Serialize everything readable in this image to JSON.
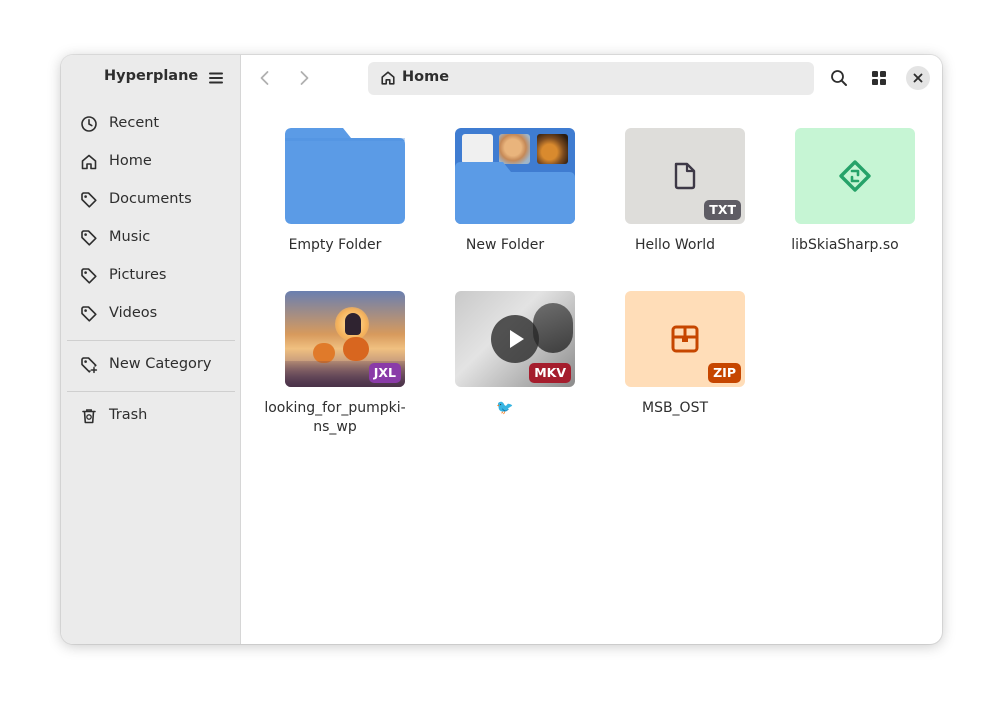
{
  "sidebar": {
    "app_title": "Hyperplane",
    "items": [
      {
        "label": "Recent",
        "icon": "clock-icon"
      },
      {
        "label": "Home",
        "icon": "home-icon"
      },
      {
        "label": "Documents",
        "icon": "tag-icon"
      },
      {
        "label": "Music",
        "icon": "tag-icon"
      },
      {
        "label": "Pictures",
        "icon": "tag-icon"
      },
      {
        "label": "Videos",
        "icon": "tag-icon"
      }
    ],
    "new_category": {
      "label": "New Category",
      "icon": "tag-add-icon"
    },
    "trash": {
      "label": "Trash",
      "icon": "trash-icon"
    }
  },
  "header": {
    "path": "Home",
    "path_icon": "home-icon"
  },
  "files": [
    {
      "name": "Empty Folder",
      "kind": "folder"
    },
    {
      "name": "New Folder",
      "kind": "folder-with-previews"
    },
    {
      "name": "Hello World",
      "kind": "text",
      "badge": "TXT",
      "badge_color": "#5e5c64"
    },
    {
      "name": "libSkiaSharp.so",
      "kind": "library",
      "icon": "library-icon",
      "bg_color": "#c6f5d4",
      "accent": "#26a269"
    },
    {
      "name": "looking_for_pumpki-ns_wp",
      "kind": "image",
      "badge": "JXL",
      "badge_color": "#8a3ba8"
    },
    {
      "name": "🐦",
      "kind": "video",
      "badge": "MKV",
      "badge_color": "#a51d2d"
    },
    {
      "name": "MSB_OST",
      "kind": "archive",
      "badge": "ZIP",
      "badge_color": "#c64600",
      "bg_color": "#ffddb8",
      "accent": "#c64600"
    }
  ],
  "colors": {
    "folder": "#5b9be6",
    "folder_dark": "#3f7cd1",
    "sidebar_bg": "#ebebeb"
  }
}
